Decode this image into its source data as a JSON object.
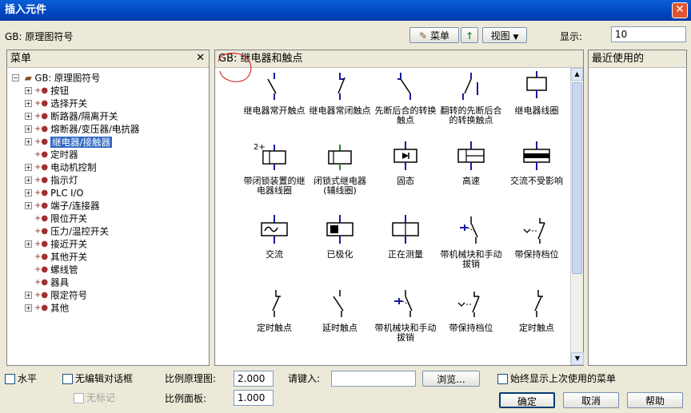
{
  "window": {
    "title": "插入元件"
  },
  "toolbar": {
    "library_label": "GB: 原理图符号",
    "menu_button": "菜单",
    "view_button": "视图",
    "display_label": "显示:",
    "display_value": "10"
  },
  "menu_panel": {
    "title": "菜单",
    "root": "GB: 原理图符号",
    "items": [
      {
        "label": "按钮",
        "expandable": true
      },
      {
        "label": "选择开关",
        "expandable": true
      },
      {
        "label": "断路器/隔离开关",
        "expandable": true
      },
      {
        "label": "熔断器/变压器/电抗器",
        "expandable": true
      },
      {
        "label": "继电器/接触器",
        "expandable": true,
        "selected": true
      },
      {
        "label": "定时器",
        "expandable": false
      },
      {
        "label": "电动机控制",
        "expandable": true
      },
      {
        "label": "指示灯",
        "expandable": true
      },
      {
        "label": "PLC I/O",
        "expandable": true
      },
      {
        "label": "端子/连接器",
        "expandable": true
      },
      {
        "label": "限位开关",
        "expandable": false
      },
      {
        "label": "压力/温控开关",
        "expandable": false
      },
      {
        "label": "接近开关",
        "expandable": true
      },
      {
        "label": "其他开关",
        "expandable": false
      },
      {
        "label": "螺线管",
        "expandable": false
      },
      {
        "label": "器具",
        "expandable": false
      },
      {
        "label": "限定符号",
        "expandable": true
      },
      {
        "label": "其他",
        "expandable": true
      }
    ]
  },
  "symbols_panel": {
    "title": "GB: 继电器和触点",
    "symbols": [
      {
        "label": "继电器常开触点",
        "icon": "no-contact"
      },
      {
        "label": "继电器常闭触点",
        "icon": "nc-contact"
      },
      {
        "label": "先断后合的转换触点",
        "icon": "changeover-contact"
      },
      {
        "label": "翻转的先断后合的转换触点",
        "icon": "flipped-changeover-contact"
      },
      {
        "label": "继电器线圈",
        "icon": "coil"
      },
      {
        "label": "带闭锁装置的继电器线圈",
        "icon": "latching-coil",
        "tag": "2+"
      },
      {
        "label": "闭锁式继电器(辅线圈)",
        "icon": "latching-aux-coil"
      },
      {
        "label": "固态",
        "icon": "solid-state"
      },
      {
        "label": "高速",
        "icon": "high-speed"
      },
      {
        "label": "交流不受影响",
        "icon": "ac-immune"
      },
      {
        "label": "交流",
        "icon": "ac-coil"
      },
      {
        "label": "已极化",
        "icon": "polarized"
      },
      {
        "label": "正在测量",
        "icon": "measuring"
      },
      {
        "label": "带机械块和手动拔销",
        "icon": "mech-block"
      },
      {
        "label": "带保持档位",
        "icon": "hold-position"
      },
      {
        "label": "定时触点",
        "icon": "timed-contact"
      },
      {
        "label": "延时触点",
        "icon": "delay-contact"
      },
      {
        "label": "带机械块和手动拔销",
        "icon": "mech-block-2"
      },
      {
        "label": "带保持档位",
        "icon": "hold-position-2"
      },
      {
        "label": "定时触点",
        "icon": "timed-contact-2"
      }
    ]
  },
  "recent_panel": {
    "title": "最近使用的"
  },
  "bottom": {
    "horizontal_label": "水平",
    "no_edit_dialog_label": "无编辑对话框",
    "no_tag_label": "无标记",
    "scale_schematic_label": "比例原理图:",
    "scale_schematic_value": "2.000",
    "scale_panel_label": "比例面板:",
    "scale_panel_value": "1.000",
    "enter_label": "请键入:",
    "enter_value": "",
    "browse_button": "浏览...",
    "always_show_label": "始终显示上次使用的菜单",
    "ok_button": "确定",
    "cancel_button": "取消",
    "help_button": "帮助"
  }
}
